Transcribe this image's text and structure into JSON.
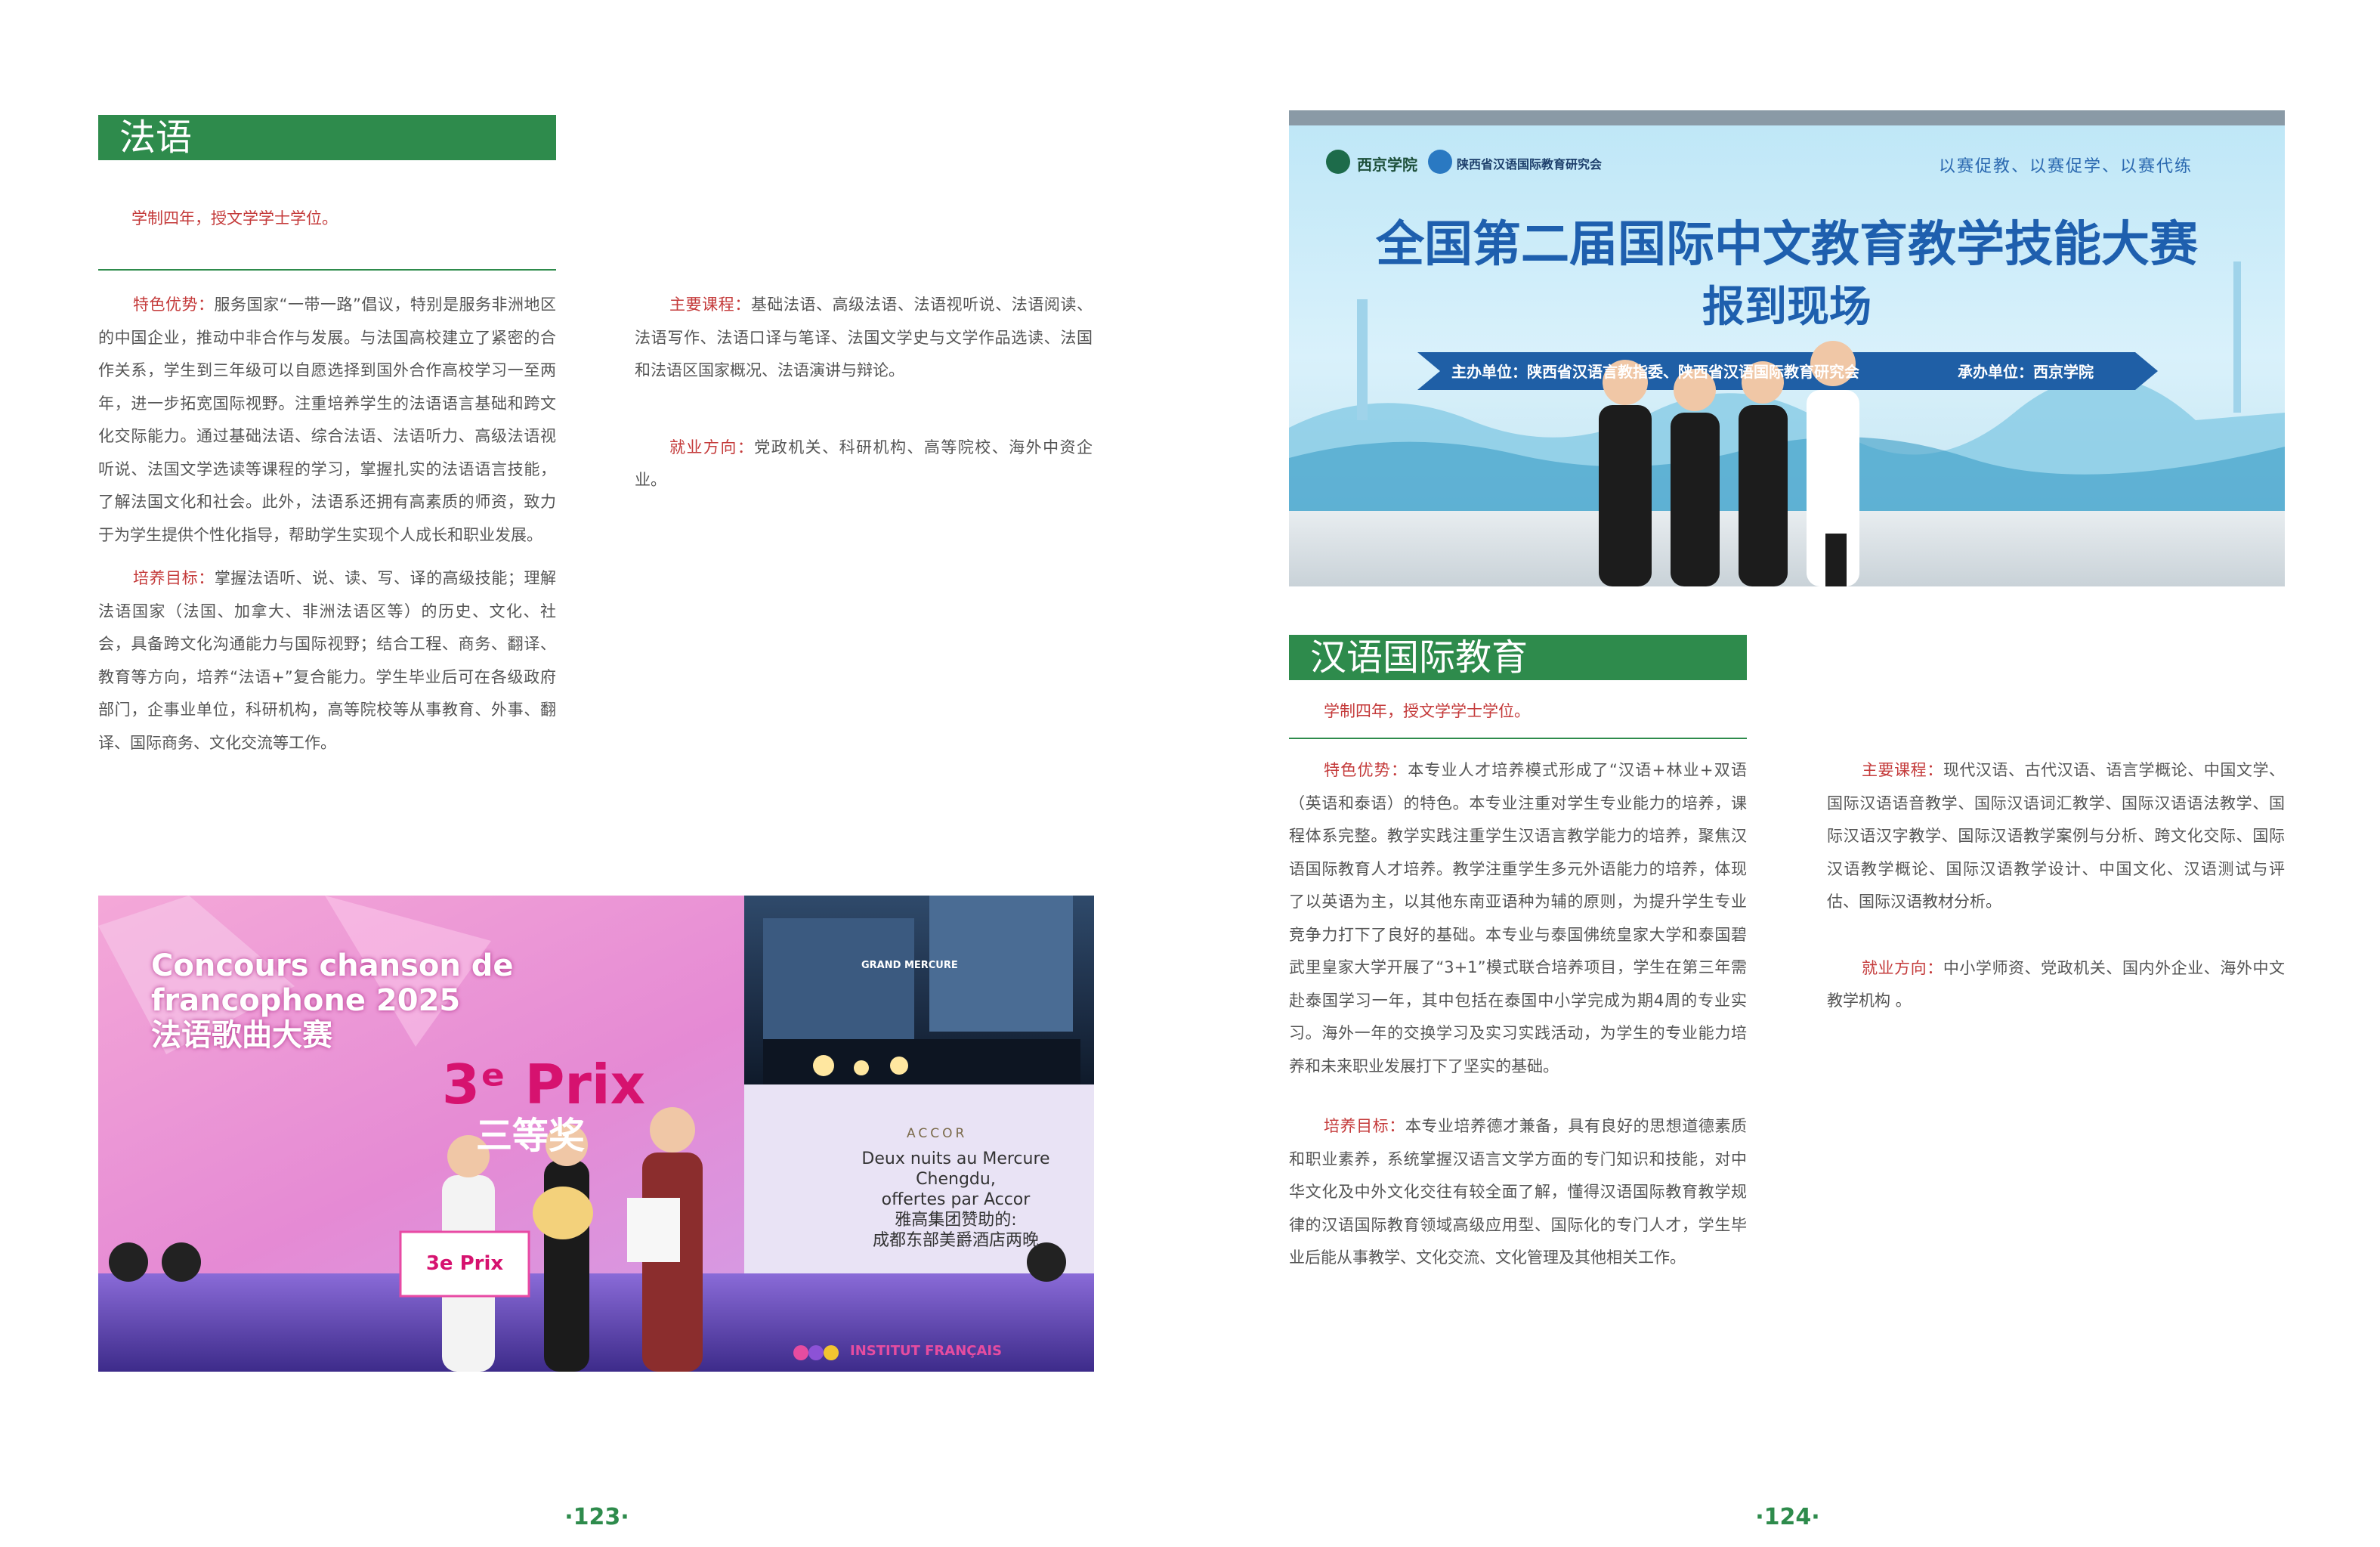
{
  "left_page": {
    "section_title": "法语",
    "duration": "学制四年，授文学学士学位。",
    "features_label": "特色优势：",
    "features_text": "服务国家“一带一路”倡议，特别是服务非洲地区的中国企业，推动中非合作与发展。与法国高校建立了紧密的合作关系，学生到三年级可以自愿选择到国外合作高校学习一至两年，进一步拓宽国际视野。注重培养学生的法语语言基础和跨文化交际能力。通过基础法语、综合法语、法语听力、高级法语视听说、法国文学选读等课程的学习，掌握扎实的法语语言技能，了解法国文化和社会。此外，法语系还拥有高素质的师资，致力于为学生提供个性化指导，帮助学生实现个人成长和职业发展。",
    "goal_label": "培养目标：",
    "goal_text": "掌握法语听、说、读、写、译的高级技能；理解法语国家（法国、加拿大、非洲法语区等）的历史、文化、社会，具备跨文化沟通能力与国际视野；结合工程、商务、翻译、教育等方向，培养“法语+”复合能力。学生毕业后可在各级政府部门，企事业单位，科研机构，高等院校等从事教育、外事、翻译、国际商务、文化交流等工作。",
    "courses_label": "主要课程：",
    "courses_text": "基础法语、高级法语、法语视听说、法语阅读、法语写作、法语口译与笔译、法国文学史与文学作品选读、法国和法语区国家概况、法语演讲与辩论。",
    "career_label": "就业方向：",
    "career_text": "党政机关、科研机构、高等院校、海外中资企业。",
    "photo": {
      "title_line1": "Concours chanson de",
      "title_line2": "francophone 2025",
      "title_cn": "法语歌曲大赛",
      "prize": "3ᵉ Prix",
      "prize_cn": "三等奖",
      "hotel_sign": "GRAND MERCURE",
      "brand": "ACCOR",
      "offer_line1": "Deux nuits au Mercure Chengdu,",
      "offer_line2": "offertes par Accor",
      "offer_cn1": "雅高集团赞助的:",
      "offer_cn2": "成都东部美爵酒店两晚",
      "board_text": "3e Prix",
      "logo_text": "INSTITUT FRANÇAIS"
    },
    "page_number": "·123·"
  },
  "right_page": {
    "section_title": "汉语国际教育",
    "duration": "学制四年，授文学学士学位。",
    "features_label": "特色优势：",
    "features_text": "本专业人才培养模式形成了“汉语+林业+双语（英语和泰语）的特色。本专业注重对学生专业能力的培养，课程体系完整。教学实践注重学生汉语言教学能力的培养，聚焦汉语国际教育人才培养。教学注重学生多元外语能力的培养，体现了以英语为主，以其他东南亚语种为辅的原则，为提升学生专业竞争力打下了良好的基础。本专业与泰国佛统皇家大学和泰国碧武里皇家大学开展了“3+1”模式联合培养项目，学生在第三年需赴泰国学习一年，其中包括在泰国中小学完成为期4周的专业实习。海外一年的交换学习及实习实践活动，为学生的专业能力培养和未来职业发展打下了坚实的基础。",
    "goal_label": "培养目标：",
    "goal_text": "本专业培养德才兼备，具有良好的思想道德素质和职业素养，系统掌握汉语言文学方面的专门知识和技能，对中华文化及中外文化交往有较全面了解，懂得汉语国际教育教学规律的汉语国际教育领域高级应用型、国际化的专门人才，学生毕业后能从事教学、文化交流、文化管理及其他相关工作。",
    "courses_label": "主要课程：",
    "courses_text": "现代汉语、古代汉语、语言学概论、中国文学、国际汉语语音教学、国际汉语词汇教学、国际汉语语法教学、国际汉语汉字教学、国际汉语教学案例与分析、跨文化交际、国际汉语教学概论、国际汉语教学设计、中国文化、汉语测试与评估、国际汉语教材分析。",
    "career_label": "就业方向：",
    "career_text": "中小学师资、党政机关、国内外企业、海外中文教学机构 。",
    "photo": {
      "logo1": "西京学院",
      "logo2": "陕西省汉语国际教育研究会",
      "slogan": "以赛促教、以赛促学、以赛代练",
      "title": "全国第二届国际中文教育教学技能大赛",
      "subtitle": "报到现场",
      "host": "主办单位：陕西省汉语言教指委、陕西省汉语国际教育研究会",
      "organizer": "承办单位：西京学院"
    },
    "page_number": "·124·"
  },
  "colors": {
    "accent_green": "#2e8b4c",
    "label_red": "#c43a3a",
    "body_text": "#555555"
  }
}
